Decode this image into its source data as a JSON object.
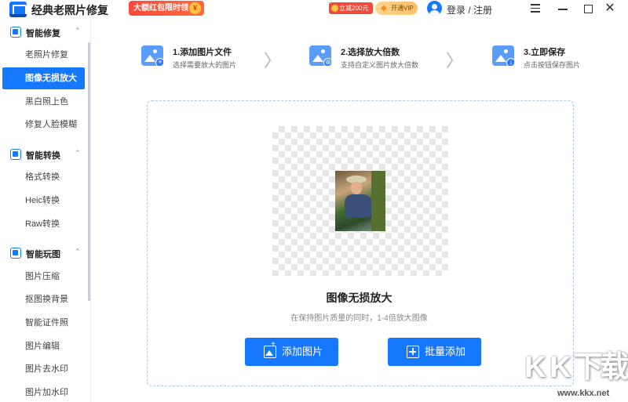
{
  "app": {
    "title": "经典老照片修复"
  },
  "header": {
    "promo_label": "大额红包限时领",
    "promo_coin": "¥",
    "coupon_label": "立减200元",
    "vip_label": "开通VIP",
    "login_label": "登录 / 注册",
    "close_glyph": "✕"
  },
  "sidebar": {
    "groups": [
      {
        "label": "智能修复",
        "chevron": "⌃",
        "items": [
          "老照片修复",
          "图像无损放大",
          "黑白照上色",
          "修复人脸模糊"
        ]
      },
      {
        "label": "智能转换",
        "chevron": "⌃",
        "items": [
          "格式转换",
          "Heic转换",
          "Raw转换"
        ]
      },
      {
        "label": "智能玩图",
        "chevron": "⌃",
        "items": [
          "图片压缩",
          "抠图换背景",
          "智能证件照",
          "图片编辑",
          "图片去水印",
          "图片加水印"
        ]
      }
    ],
    "active_item": "图像无损放大"
  },
  "steps": [
    {
      "title": "1.添加图片文件",
      "desc": "选择需要放大的图片",
      "badge": "+"
    },
    {
      "title": "2.选择放大倍数",
      "desc": "支持自定义图片放大倍数",
      "badge": "⊕"
    },
    {
      "title": "3.立即保存",
      "desc": "点击按钮保存图片",
      "badge": "↓"
    }
  ],
  "step_chevron": "〉",
  "main": {
    "title": "图像无损放大",
    "subtitle": "在保持图片质量的同时，1-4倍放大图像",
    "add_button": "添加图片",
    "batch_button": "批量添加"
  },
  "watermark": {
    "letters": [
      "K",
      "K",
      "下",
      "载"
    ],
    "url": "www.kkx.net"
  },
  "colors": {
    "accent": "#1677ff",
    "promo": "#ff4a3a",
    "vip": "#ffc069"
  }
}
